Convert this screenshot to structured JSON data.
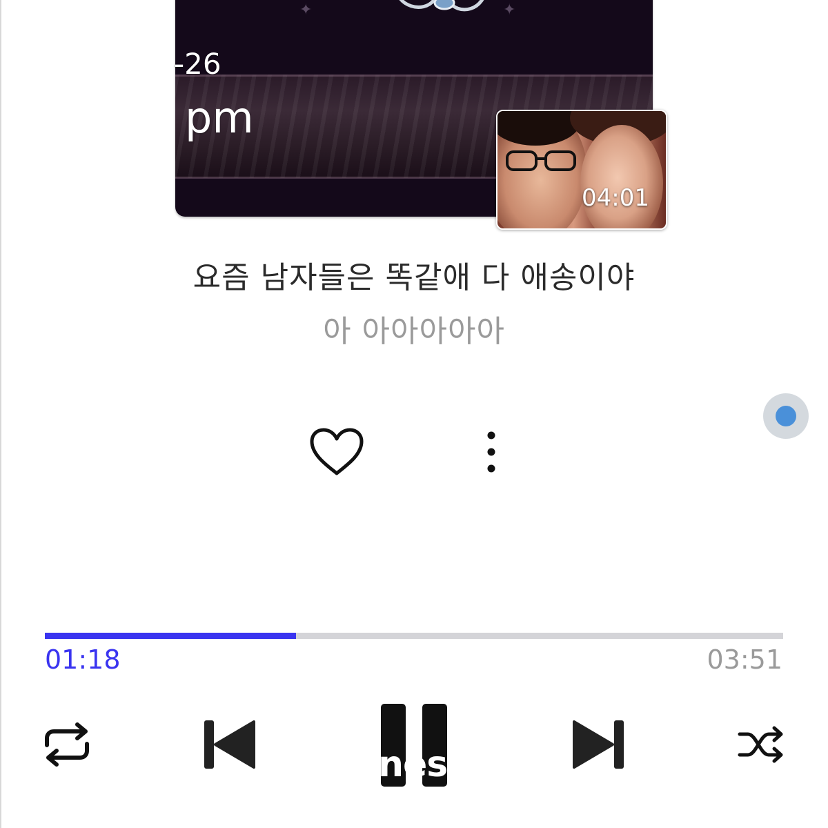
{
  "overlay": {
    "date_fragment": "-26",
    "time_fragment": "pm"
  },
  "video": {
    "duration": "04:01"
  },
  "song": {
    "title": "요즘 남자들은 똑같애 다 애송이야",
    "artist": "아 아아아아아"
  },
  "actions": {
    "like_icon": "heart-outline-icon",
    "more_icon": "vertical-dots-icon"
  },
  "playback": {
    "elapsed": "01:18",
    "total": "03:51",
    "progress_fraction": 0.34,
    "accent_color": "#3a34f0",
    "track_color": "#d4d4d8"
  },
  "controls": {
    "repeat_icon": "repeat-icon",
    "prev_icon": "skip-previous-icon",
    "pause_icon": "pause-icon",
    "next_icon": "skip-next-icon",
    "shuffle_icon": "shuffle-icon"
  },
  "watermark": {
    "text": "nesp"
  }
}
